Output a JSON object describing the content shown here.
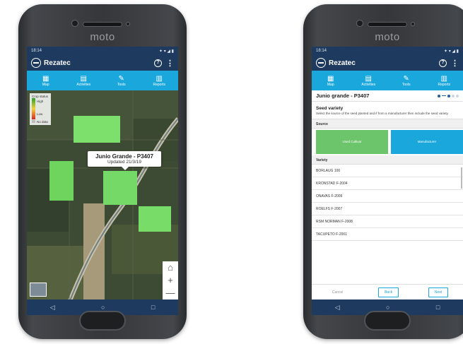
{
  "device": {
    "brand": "moto"
  },
  "status": {
    "time": "18:14",
    "icons": "✦ ▾ ◢ ▮"
  },
  "app": {
    "name": "Rezatec",
    "help": "?",
    "more": "⋮"
  },
  "tabs": [
    {
      "label": "Map",
      "icon": "map-icon"
    },
    {
      "label": "Activities",
      "icon": "calendar-icon"
    },
    {
      "label": "Tools",
      "icon": "edit-icon"
    },
    {
      "label": "Reports",
      "icon": "chart-icon"
    }
  ],
  "legend": {
    "title": "Crop status",
    "high": "High",
    "low": "Low",
    "no_data": "No data"
  },
  "popup": {
    "title": "Junio Grande - P3407",
    "updated": "Updated 21/3/19"
  },
  "map_controls": {
    "home": "⌂",
    "zoom_in": "+",
    "zoom_out": "—"
  },
  "android_nav": {
    "back": "◁",
    "home": "○",
    "recent": "□"
  },
  "seed": {
    "field_title": "Junio grande - P3407",
    "heading": "Seed variety",
    "description": "Select the source of the seed planted and if from a manufacturer then include the seed variety.",
    "source_label": "Source",
    "own_button": "Used Cultivar",
    "manufacturer_button": "Manufacturer",
    "variety_label": "Variety",
    "varieties": [
      "BORLAUG 100",
      "KRONSTAD F-2004",
      "ONAVAS F-2009",
      "ROELFS F-2007",
      "RSM NORMAN F-2008",
      "TACUPETO F-2001"
    ],
    "cancel": "Cancel",
    "back": "Back",
    "next": "Next"
  },
  "colors": {
    "appbar": "#1e3a5f",
    "tabbar": "#1aa7dc",
    "own": "#6cc46b",
    "manufacturer": "#1aa7dc"
  }
}
